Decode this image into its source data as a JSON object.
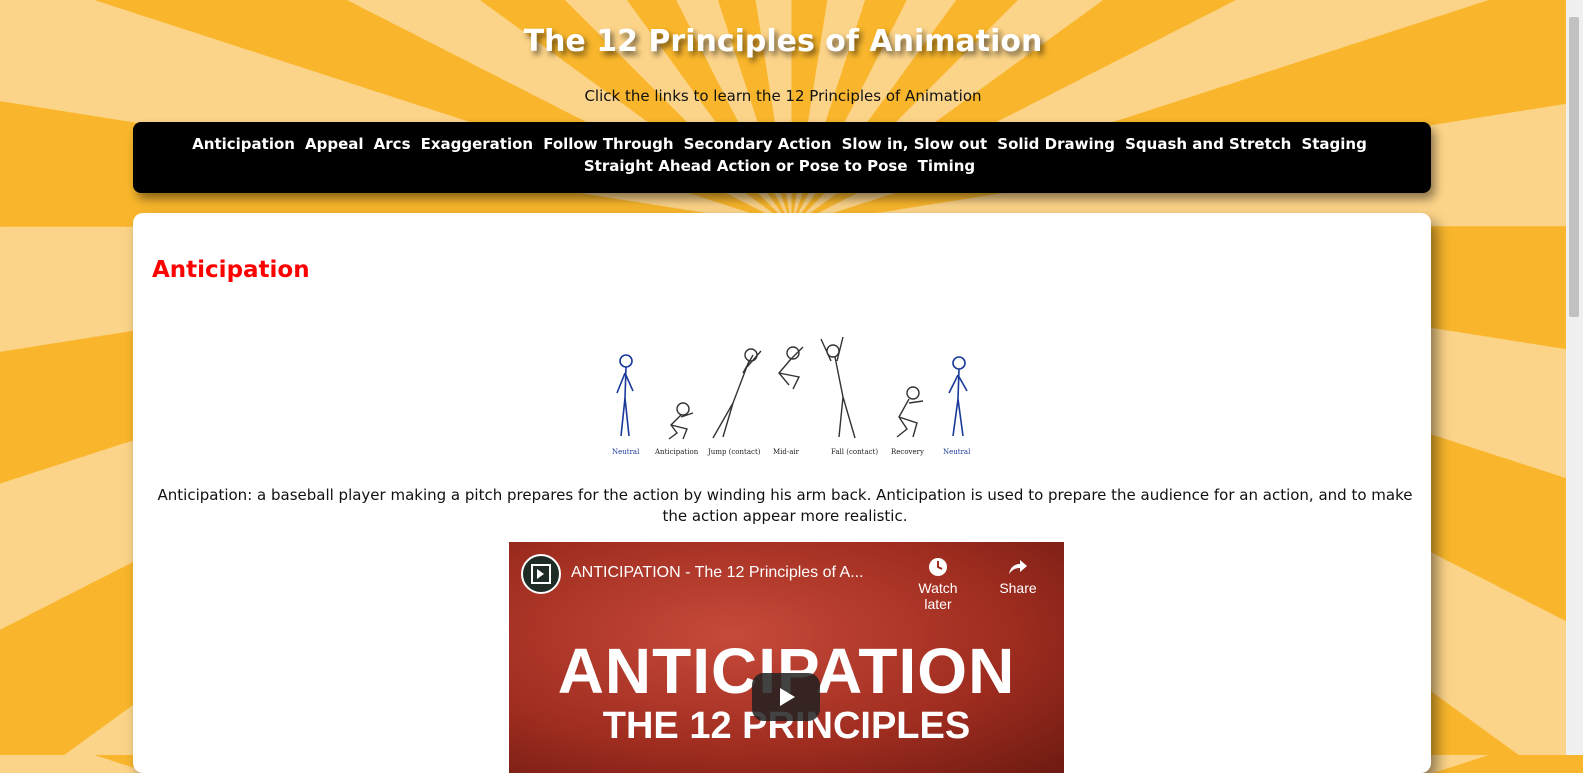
{
  "page": {
    "title": "The 12 Principles of Animation",
    "subtitle": "Click the links to learn the 12 Principles of Animation"
  },
  "nav": {
    "links": [
      "Anticipation",
      "Appeal",
      "Arcs",
      "Exaggeration",
      "Follow Through",
      "Secondary Action",
      "Slow in, Slow out",
      "Solid Drawing",
      "Squash and Stretch",
      "Staging",
      "Straight Ahead Action or Pose to Pose",
      "Timing"
    ]
  },
  "section": {
    "heading": "Anticipation",
    "sprite_labels": [
      "Neutral",
      "Anticipation",
      "Jump (contact)",
      "Mid-air",
      "Fall (contact)",
      "Recovery",
      "Neutral"
    ],
    "caption": "Anticipation: a baseball player making a pitch prepares for the action by winding his arm back. Anticipation is used to prepare the audience for an action, and to make the action appear more realistic."
  },
  "video": {
    "title": "ANTICIPATION - The 12 Principles of A...",
    "watch_later": "Watch later",
    "share": "Share",
    "thumb_line1": "ANTICIPATION",
    "thumb_line2": "THE 12 PRINCIPLES"
  },
  "colors": {
    "heading": "#ff0000",
    "nav_bg": "#000000",
    "background_stripe_a": "#f9b62c",
    "background_stripe_b": "#fcd489"
  }
}
